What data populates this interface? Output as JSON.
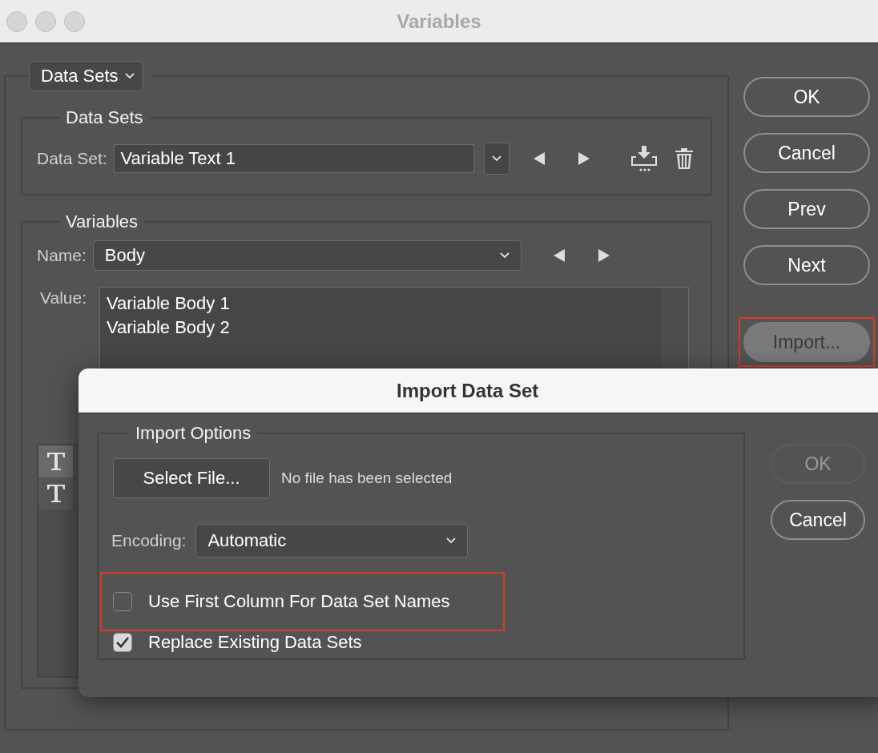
{
  "window": {
    "title": "Variables"
  },
  "view_menu": {
    "label": "Data Sets"
  },
  "data_sets": {
    "legend": "Data Sets",
    "label": "Data Set:",
    "value": "Variable Text 1"
  },
  "variables": {
    "legend": "Variables",
    "name_label": "Name:",
    "name_value": "Body",
    "value_label": "Value:",
    "value_lines": [
      "Variable Body 1",
      "Variable Body 2"
    ],
    "list_rows": [
      {
        "selected": true
      },
      {
        "selected": false
      }
    ]
  },
  "buttons": [
    {
      "label": "OK",
      "pressed": false,
      "highlighted": false
    },
    {
      "label": "Cancel",
      "pressed": false,
      "highlighted": false
    },
    {
      "label": "Prev",
      "pressed": false,
      "highlighted": false
    },
    {
      "label": "Next",
      "pressed": false,
      "highlighted": false
    },
    {
      "label": "Import...",
      "pressed": true,
      "highlighted": true
    }
  ],
  "dialog": {
    "title": "Import Data Set",
    "legend": "Import Options",
    "select_button": "Select File...",
    "file_status": "No file has been selected",
    "encoding_label": "Encoding:",
    "encoding_value": "Automatic",
    "options": [
      {
        "label": "Use First Column For Data Set Names",
        "checked": false,
        "highlighted": true
      },
      {
        "label": "Replace Existing Data Sets",
        "checked": true,
        "highlighted": false
      }
    ],
    "buttons": [
      {
        "label": "OK",
        "disabled": true
      },
      {
        "label": "Cancel",
        "disabled": false
      }
    ]
  }
}
